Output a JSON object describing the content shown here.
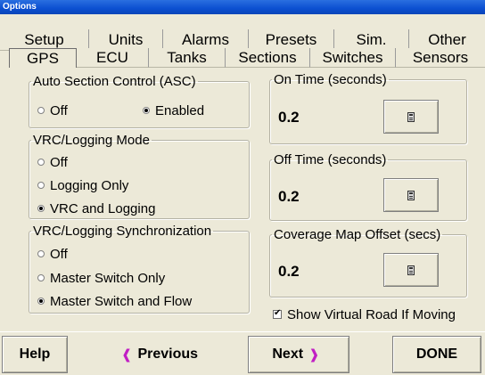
{
  "window": {
    "title": "Options"
  },
  "tabs_row1": [
    "Setup",
    "Units",
    "Alarms",
    "Presets",
    "Sim.",
    "Other"
  ],
  "tabs_row2": [
    "GPS",
    "ECU",
    "Tanks",
    "Sections",
    "Switches",
    "Sensors"
  ],
  "active_tab": "GPS",
  "asc": {
    "title": "Auto Section Control (ASC)",
    "options": [
      "Off",
      "Enabled"
    ],
    "selected": "Enabled"
  },
  "vrc_mode": {
    "title": "VRC/Logging Mode",
    "options": [
      "Off",
      "Logging Only",
      "VRC and Logging"
    ],
    "selected": "VRC and Logging"
  },
  "vrc_sync": {
    "title": "VRC/Logging Synchronization",
    "options": [
      "Off",
      "Master Switch Only",
      "Master Switch and Flow"
    ],
    "selected": "Master Switch and Flow"
  },
  "on_time": {
    "title": "On Time (seconds)",
    "value": "0.2"
  },
  "off_time": {
    "title": "Off Time (seconds)",
    "value": "0.2"
  },
  "coverage_offset": {
    "title": "Coverage Map Offset (secs)",
    "value": "0.2"
  },
  "show_virtual_road": {
    "label": "Show Virtual Road If Moving",
    "checked": true
  },
  "footer": {
    "help": "Help",
    "previous": "Previous",
    "next": "Next",
    "done": "DONE"
  },
  "icons": {
    "calculator": "calculator-icon",
    "left_arrow": "chevron-left-icon",
    "right_arrow": "chevron-right-icon"
  },
  "colors": {
    "titlebar": "#0b4fd1",
    "arrow": "#c11fc4",
    "background": "#ece9d8"
  }
}
